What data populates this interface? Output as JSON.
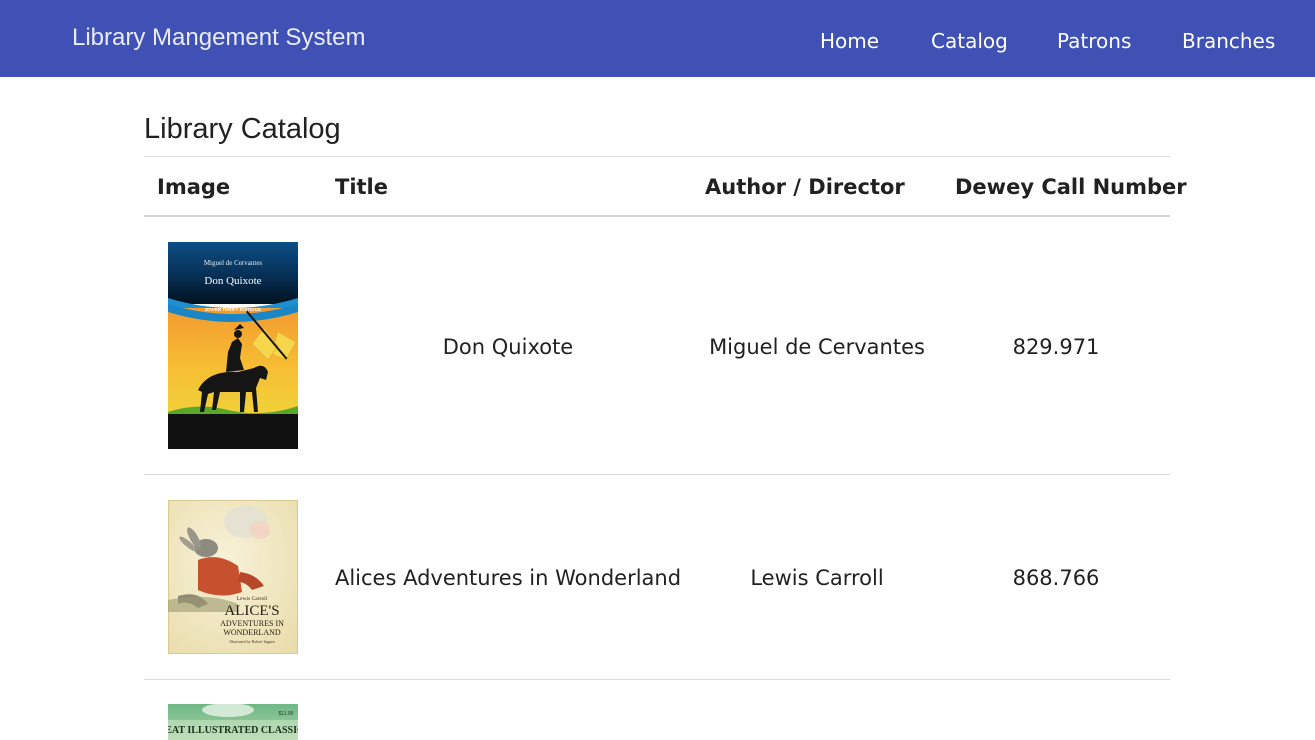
{
  "navbar": {
    "brand": "Library Mangement System",
    "links": [
      "Home",
      "Catalog",
      "Patrons",
      "Branches"
    ],
    "color": "#3f51b5"
  },
  "main": {
    "title": "Library Catalog",
    "columns": [
      "Image",
      "Title",
      "Author / Director",
      "Dewey Call Number"
    ],
    "rows": [
      {
        "cover": "don-quixote-cover",
        "cover_author": "Miguel de Cervantes",
        "cover_title": "Don Quixote",
        "cover_series": "DOVER THRIFT EDITIONS",
        "title": "Don Quixote",
        "author": "Miguel de Cervantes",
        "dewey": "829.971"
      },
      {
        "cover": "alice-cover",
        "cover_author": "Lewis Carroll",
        "cover_title_line1": "ALICE'S",
        "cover_title_line2": "ADVENTURES IN",
        "cover_title_line3": "WONDERLAND",
        "cover_illustrator": "Illustrated by Robert Ingpen",
        "title": "Alices Adventures in Wonderland",
        "author": "Lewis Carroll",
        "dewey": "868.766"
      },
      {
        "cover": "great-illustrated-classics-cover",
        "cover_title": "GREAT ILLUSTRATED CLASSICS",
        "cover_price": "$11.99"
      }
    ]
  }
}
